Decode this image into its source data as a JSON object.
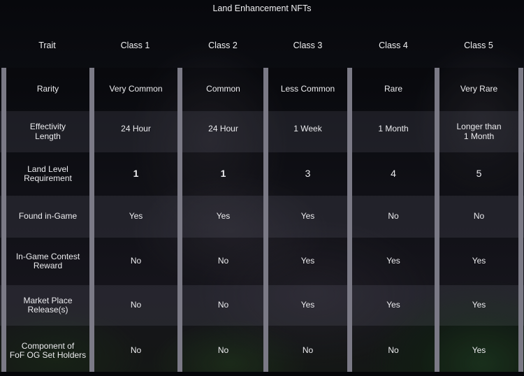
{
  "title": "Land Enhancement NFTs",
  "columns": [
    "Trait",
    "Class 1",
    "Class 2",
    "Class 3",
    "Class 4",
    "Class 5"
  ],
  "rows": [
    {
      "trait": "Rarity",
      "values": [
        "Very Common",
        "Common",
        "Less Common",
        "Rare",
        "Very Rare"
      ]
    },
    {
      "trait": "Effectivity\nLength",
      "values": [
        "24 Hour",
        "24 Hour",
        "1 Week",
        "1 Month",
        "Longer than\n1 Month"
      ]
    },
    {
      "trait": "Land Level\nRequirement",
      "values": [
        "1",
        "1",
        "3",
        "4",
        "5"
      ]
    },
    {
      "trait": "Found in-Game",
      "values": [
        "Yes",
        "Yes",
        "Yes",
        "No",
        "No"
      ]
    },
    {
      "trait": "In-Game Contest\nReward",
      "values": [
        "No",
        "No",
        "Yes",
        "Yes",
        "Yes"
      ]
    },
    {
      "trait": "Market Place\nRelease(s)",
      "values": [
        "No",
        "No",
        "Yes",
        "Yes",
        "Yes"
      ]
    },
    {
      "trait": "Component of\nFoF OG Set Holders",
      "values": [
        "No",
        "No",
        "No",
        "No",
        "Yes"
      ]
    }
  ],
  "colors": {
    "separator": "#7b7a86",
    "text": "#ececef"
  }
}
